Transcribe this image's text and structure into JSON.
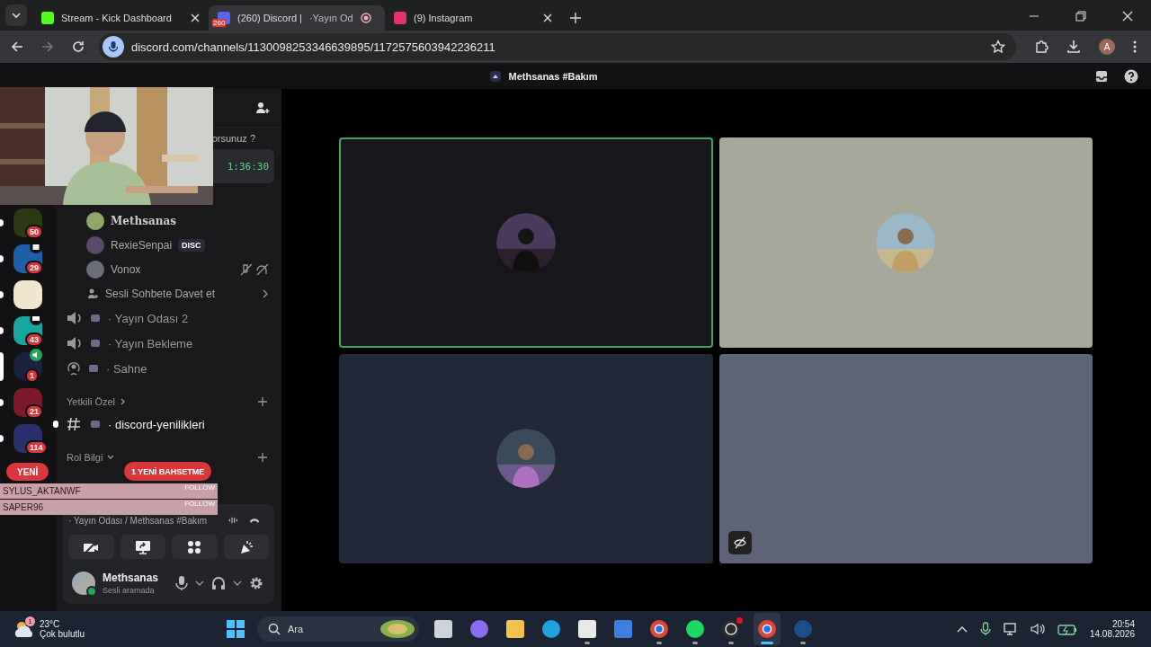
{
  "browser": {
    "tabs": [
      {
        "title": "Stream - Kick Dashboard",
        "kind": "kick",
        "selected": false,
        "recording": false
      },
      {
        "title": "(260) Discord |",
        "extra": "·Yayın Od",
        "badge": "260",
        "kind": "discord",
        "selected": true,
        "recording": true
      },
      {
        "title": "(9) Instagram",
        "kind": "instagram",
        "selected": false,
        "recording": false
      }
    ],
    "url": "discord.com/channels/1130098253346639895/1172575603942236211",
    "profile": "A"
  },
  "discord": {
    "title": "Methsanas #Bakım",
    "servers": [
      {
        "kind": "plain",
        "badge": "50",
        "color": "#2b3a12",
        "unread": true,
        "selected": false
      },
      {
        "kind": "event",
        "badge": "29",
        "color": "#1f5fa8",
        "unread": true,
        "selected": false
      },
      {
        "kind": "plain",
        "color": "#f3e6cf",
        "unread": true,
        "selected": false
      },
      {
        "kind": "screen",
        "badge": "43",
        "color": "#1aa6a0",
        "unread": true,
        "selected": false
      },
      {
        "kind": "voice",
        "badge": "1",
        "color": "#1b2040",
        "selected": true
      },
      {
        "kind": "plain",
        "badge": "21",
        "color": "#7a1a2a",
        "unread": true,
        "selected": false
      },
      {
        "kind": "plain",
        "badge": "114",
        "color": "#2a2f6e",
        "unread": true,
        "selected": false
      }
    ],
    "new_pill": "YENİ",
    "chat_preview": {
      "text": "orsunuz ?",
      "time": "1:36:30"
    },
    "voice_users": [
      {
        "name": "Methsanas",
        "decorated": true,
        "muted": false,
        "color": "#8fa86a"
      },
      {
        "name": "RexieSenpai",
        "tag": "DISC",
        "decorated": false,
        "muted": false,
        "color": "#5a4a6a"
      },
      {
        "name": "Vonox",
        "decorated": false,
        "muted": true,
        "color": "#6b6f7a"
      }
    ],
    "invite": "Sesli Sohbete Davet et",
    "channels": [
      {
        "kind": "voice",
        "name": "· Yayın Odası 2",
        "unread": false
      },
      {
        "kind": "voice",
        "name": "· Yayın Bekleme",
        "unread": false
      },
      {
        "kind": "stage",
        "name": "· Sahne",
        "unread": false
      },
      {
        "kind": "category",
        "name": "Yetkili Özel",
        "expanded": false
      },
      {
        "kind": "text",
        "name": "· discord-yenilikleri",
        "unread": true
      },
      {
        "kind": "category",
        "name": "Rol Bilgi",
        "expanded": true
      }
    ],
    "mention_pill": "1 YENİ BAHSETME",
    "voice_panel": {
      "location": "· Yayın Odası / Methsanas #Bakım"
    },
    "user": {
      "name": "Methsanas",
      "status": "Sesli aramada"
    },
    "tiles": [
      {
        "color": "#17171b",
        "speaking": true,
        "avatar": true,
        "camera_off": false
      },
      {
        "color": "#a6a89c",
        "speaking": false,
        "avatar": true,
        "camera_off": false
      },
      {
        "color": "#232838",
        "speaking": false,
        "avatar": true,
        "camera_off": false
      },
      {
        "color": "#5e6378",
        "speaking": false,
        "avatar": false,
        "camera_off": true
      }
    ]
  },
  "overlay": {
    "follows": [
      {
        "name": "SYLUS_AKTANWF",
        "action": "FOLLOW"
      },
      {
        "name": "SAPER96",
        "action": "FOLLOW"
      }
    ]
  },
  "taskbar": {
    "weather": {
      "temperature": "23°C",
      "condition": "Çok bulutlu",
      "badge": "1"
    },
    "search": "Ara",
    "apps": [
      {
        "kind": "taskview",
        "running": false,
        "active": false
      },
      {
        "kind": "copilot",
        "running": false,
        "active": false
      },
      {
        "kind": "folder",
        "running": false,
        "active": false
      },
      {
        "kind": "edge",
        "running": false,
        "active": false
      },
      {
        "kind": "store",
        "running": true,
        "active": false
      },
      {
        "kind": "mail",
        "running": false,
        "active": false
      },
      {
        "kind": "chrome",
        "running": true,
        "active": false
      },
      {
        "kind": "spotify",
        "running": true,
        "active": false
      },
      {
        "kind": "obs",
        "running": true,
        "active": false
      },
      {
        "kind": "chrome",
        "running": true,
        "active": true
      },
      {
        "kind": "steam",
        "running": true,
        "active": false
      }
    ],
    "time": "20:54",
    "date": "14.08.2026"
  }
}
